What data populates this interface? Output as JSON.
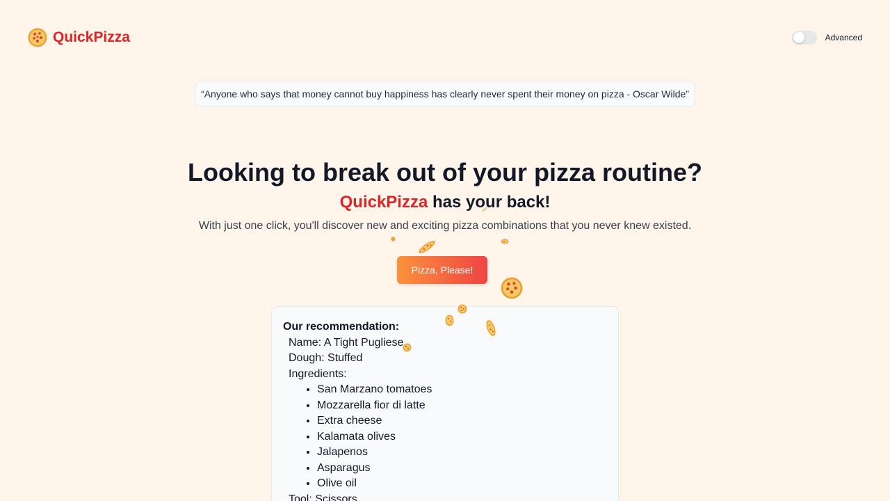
{
  "header": {
    "brand_name": "QuickPizza",
    "logo_icon": "pizza-icon",
    "advanced_label": "Advanced",
    "advanced_enabled": false
  },
  "quote": {
    "text": "“Anyone who says that money cannot buy happiness has clearly never spent their money on pizza - Oscar Wilde”"
  },
  "hero": {
    "title": "Looking to break out of your pizza routine?",
    "subtitle_brand": "QuickPizza",
    "subtitle_rest": " has your back!",
    "description": "With just one click, you'll discover new and exciting pizza combinations that you never knew existed."
  },
  "cta": {
    "label": "Pizza, Please!"
  },
  "recommendation": {
    "heading": "Our recommendation:",
    "name_line": "Name: A Tight Pugliese",
    "dough_line": "Dough: Stuffed",
    "ingredients_label": "Ingredients:",
    "ingredients": [
      "San Marzano tomatoes",
      "Mozzarella fior di latte",
      "Extra cheese",
      "Kalamata olives",
      "Jalapenos",
      "Asparagus",
      "Olive oil"
    ],
    "tool_line": "Tool: Scissors"
  },
  "colors": {
    "background": "#fff5eb",
    "brand_red": "#dc2626",
    "button_gradient_start": "#fb923c",
    "button_gradient_end": "#ef4444"
  }
}
